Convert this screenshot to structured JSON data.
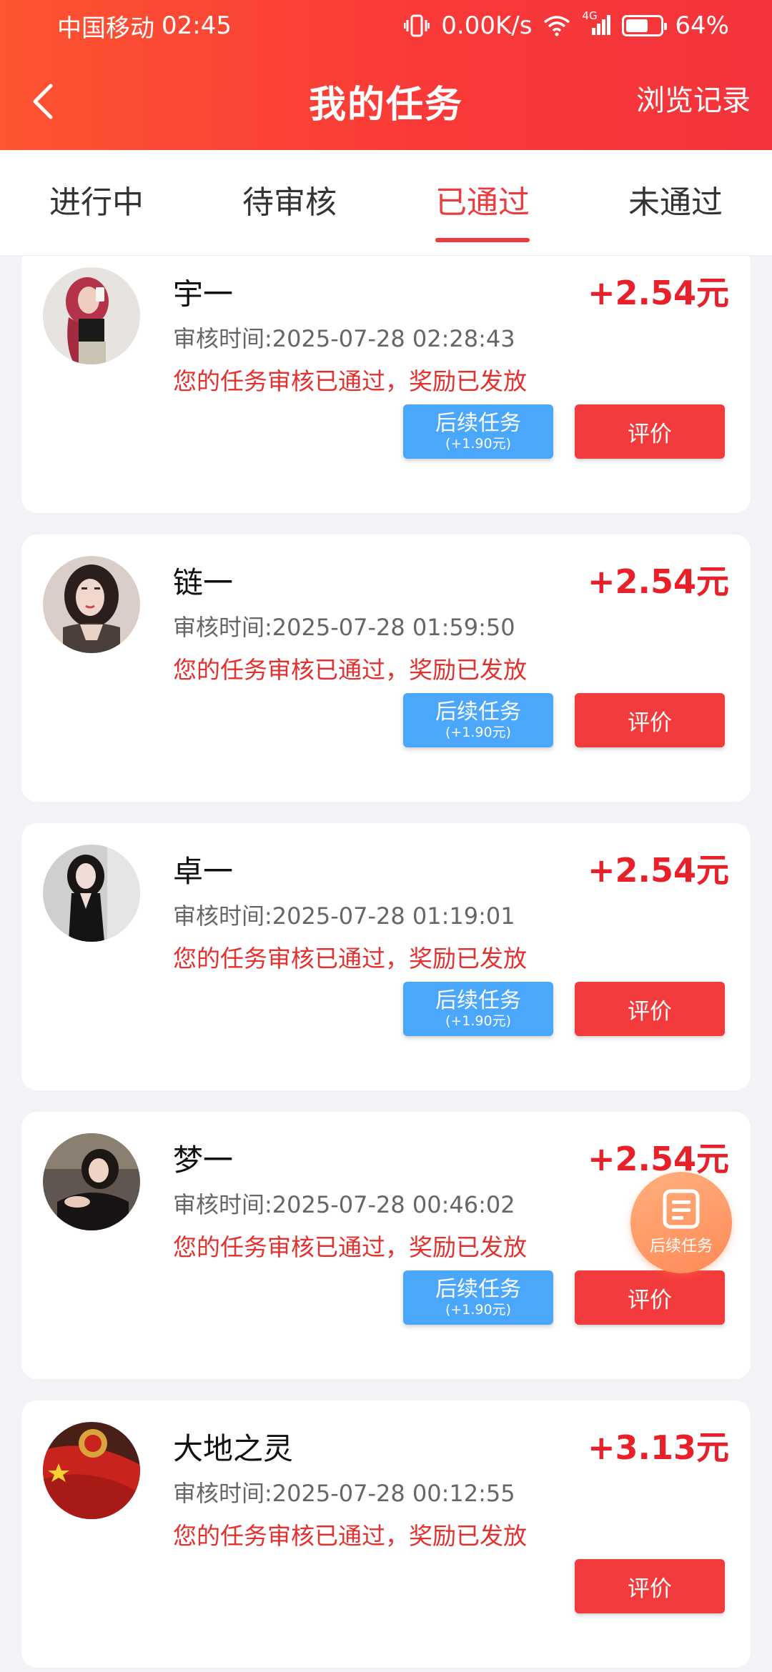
{
  "status_bar": {
    "carrier": "中国移动",
    "time": "02:45",
    "network_speed": "0.00K/s",
    "signal_type": "4G",
    "battery_level": "64%",
    "battery_fraction": 0.64
  },
  "nav": {
    "title": "我的任务",
    "right_link": "浏览记录",
    "back_icon": "chevron-left-icon"
  },
  "tabs": [
    {
      "label": "进行中",
      "active": false
    },
    {
      "label": "待审核",
      "active": false
    },
    {
      "label": "已通过",
      "active": true
    },
    {
      "label": "未通过",
      "active": false
    }
  ],
  "tasks": [
    {
      "name": "宇一",
      "amount": "+2.54元",
      "time_label": "审核时间:2025-07-28 02:28:43",
      "status": "您的任务审核已通过，奖励已发放",
      "followup_label": "后续任务",
      "followup_sub": "(+1.90元)",
      "has_followup": true,
      "review_label": "评价"
    },
    {
      "name": "链一",
      "amount": "+2.54元",
      "time_label": "审核时间:2025-07-28 01:59:50",
      "status": "您的任务审核已通过，奖励已发放",
      "followup_label": "后续任务",
      "followup_sub": "(+1.90元)",
      "has_followup": true,
      "review_label": "评价"
    },
    {
      "name": "卓一",
      "amount": "+2.54元",
      "time_label": "审核时间:2025-07-28 01:19:01",
      "status": "您的任务审核已通过，奖励已发放",
      "followup_label": "后续任务",
      "followup_sub": "(+1.90元)",
      "has_followup": true,
      "review_label": "评价"
    },
    {
      "name": "梦一",
      "amount": "+2.54元",
      "time_label": "审核时间:2025-07-28 00:46:02",
      "status": "您的任务审核已通过，奖励已发放",
      "followup_label": "后续任务",
      "followup_sub": "(+1.90元)",
      "has_followup": true,
      "review_label": "评价"
    },
    {
      "name": "大地之灵",
      "amount": "+3.13元",
      "time_label": "审核时间:2025-07-28 00:12:55",
      "status": "您的任务审核已通过，奖励已发放",
      "has_followup": false,
      "review_label": "评价"
    }
  ],
  "fab": {
    "label": "后续任务",
    "icon": "document-icon"
  },
  "colors": {
    "header_start": "#fe5431",
    "header_end": "#f3343c",
    "accent_red": "#e8202a",
    "followup_blue": "#4aa7fb",
    "review_red": "#f33b3d",
    "fab_orange": "#ff8a58"
  }
}
